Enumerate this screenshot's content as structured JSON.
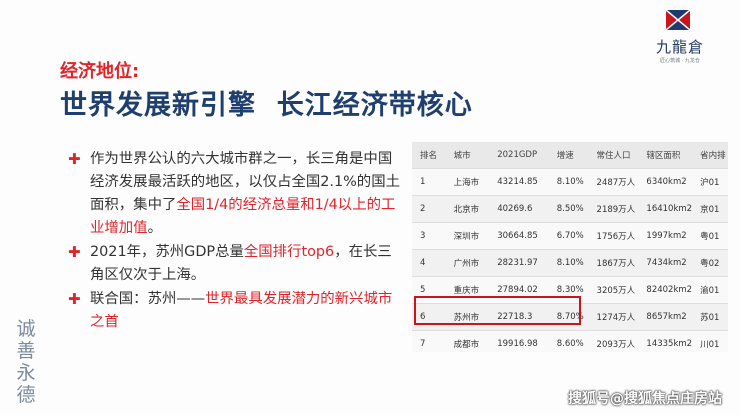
{
  "logo": {
    "name": "九龍倉",
    "tagline": "匠心筑城 · 九龙仓"
  },
  "subtitle": "经济地位:",
  "title": "世界发展新引擎  长江经济带核心",
  "bullets": [
    {
      "text_parts": [
        {
          "text": "作为世界公认的六大城市群之一，长三角是中国经济发展最活跃的地区，以仅占全国2.1%的国土面积，集中了",
          "red": false
        },
        {
          "text": "全国1/4的经济总量和1/4以上的工业增加值",
          "red": true
        },
        {
          "text": "。",
          "red": false
        }
      ]
    },
    {
      "text_parts": [
        {
          "text": "2021年，苏州GDP总量",
          "red": false
        },
        {
          "text": "全国排行top6",
          "red": true
        },
        {
          "text": "，在长三角区仅次于上海。",
          "red": false
        }
      ]
    },
    {
      "text_parts": [
        {
          "text": "联合国：苏州——",
          "red": false
        },
        {
          "text": "世界最具发展潜力的新兴城市之首",
          "red": true
        }
      ]
    }
  ],
  "table": {
    "headers": [
      "排名",
      "城市",
      "2021GDP",
      "增速",
      "常住人口",
      "辖区面积",
      "省内排"
    ],
    "rows": [
      [
        "1",
        "上海市",
        "43214.85",
        "8.10%",
        "2487万人",
        "6340km2",
        "沪01"
      ],
      [
        "2",
        "北京市",
        "40269.6",
        "8.50%",
        "2189万人",
        "16410km2",
        "京01"
      ],
      [
        "3",
        "深圳市",
        "30664.85",
        "6.70%",
        "1756万人",
        "1997km2",
        "粤01"
      ],
      [
        "4",
        "广州市",
        "28231.97",
        "8.10%",
        "1867万人",
        "7434km2",
        "粤02"
      ],
      [
        "5",
        "重庆市",
        "27894.02",
        "8.30%",
        "3205万人",
        "82402km2",
        "渝01"
      ],
      [
        "6",
        "苏州市",
        "22718.3",
        "8.70%",
        "1274万人",
        "8657km2",
        "苏01"
      ],
      [
        "7",
        "成都市",
        "19916.98",
        "8.60%",
        "2093万人",
        "14335km2",
        "川01"
      ]
    ],
    "highlight_rank": "6"
  },
  "calligraphy": [
    "诚",
    "善",
    "永",
    "德"
  ],
  "watermark": "搜狐号@搜狐焦点庄房站",
  "colors": {
    "accent_red": "#e0242a",
    "title_blue": "#1f3f6e"
  }
}
